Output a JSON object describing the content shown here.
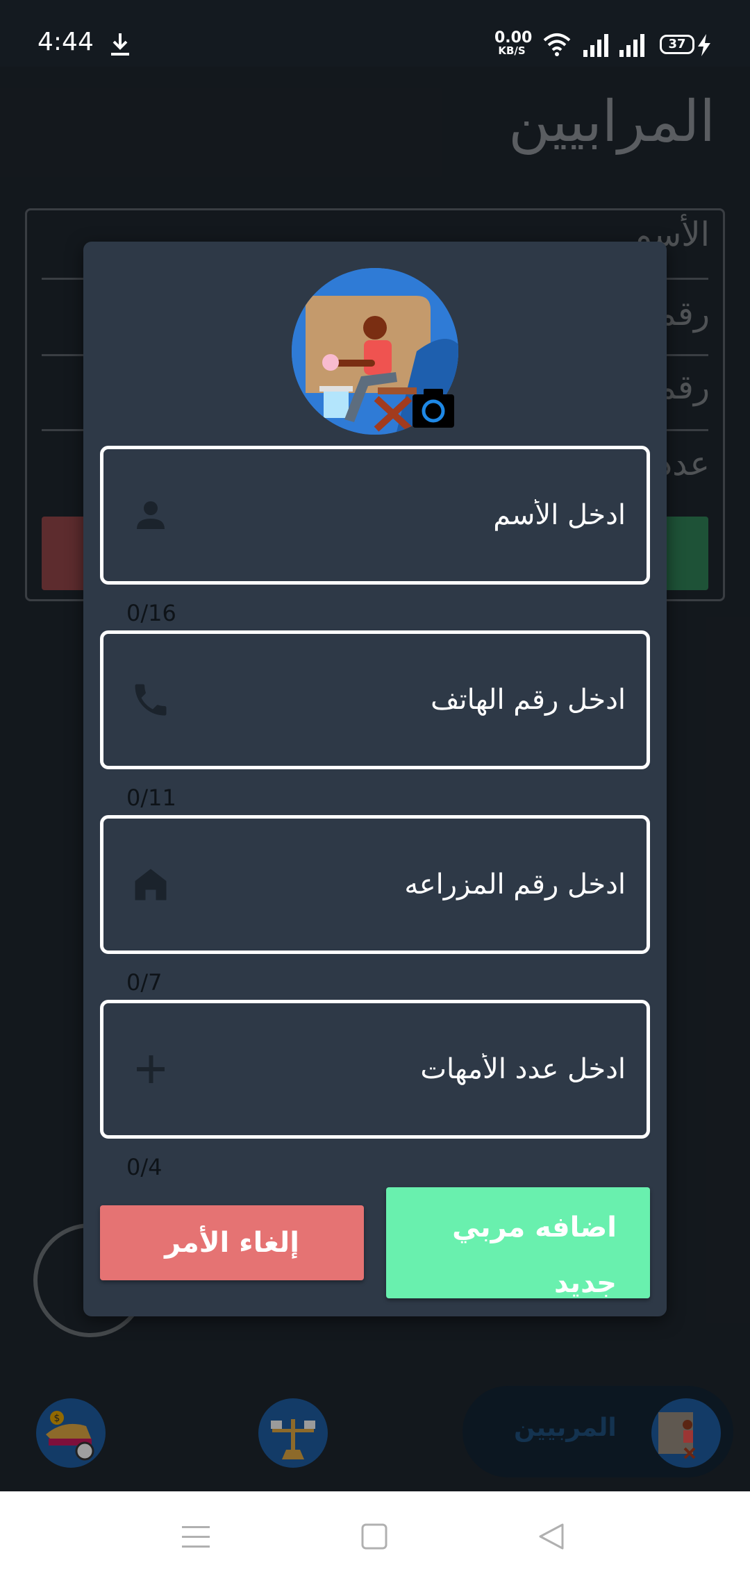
{
  "status_bar": {
    "time": "4:44",
    "net_speed_value": "0.00",
    "net_speed_unit": "KB/S",
    "battery": "37",
    "icons": [
      "download-icon",
      "wifi-icon",
      "signal-icon",
      "signal-icon",
      "battery-icon",
      "charging-icon"
    ]
  },
  "background": {
    "page_title": "المرابيين",
    "labels": [
      "الأسم",
      "رقم",
      "رقم",
      "عدد"
    ]
  },
  "dialog": {
    "fields": [
      {
        "placeholder": "ادخل الأسم",
        "counter": "0/16",
        "icon": "person-icon"
      },
      {
        "placeholder": "ادخل رقم الهاتف",
        "counter": "0/11",
        "icon": "phone-icon"
      },
      {
        "placeholder": "ادخل رقم المزراعه",
        "counter": "0/7",
        "icon": "home-icon"
      },
      {
        "placeholder": "ادخل عدد الأمهات",
        "counter": "0/4",
        "icon": "plus-icon"
      }
    ],
    "cancel_label": "إلغاء الأمر",
    "add_label": "اضافه مربي جديد"
  },
  "bottom_nav": {
    "active_label": "المربيين"
  },
  "colors": {
    "background": "#1e252d",
    "dialog": "#2e3947",
    "cancel": "#e57373",
    "add": "#69f0ae",
    "nav_active": "#132434"
  }
}
